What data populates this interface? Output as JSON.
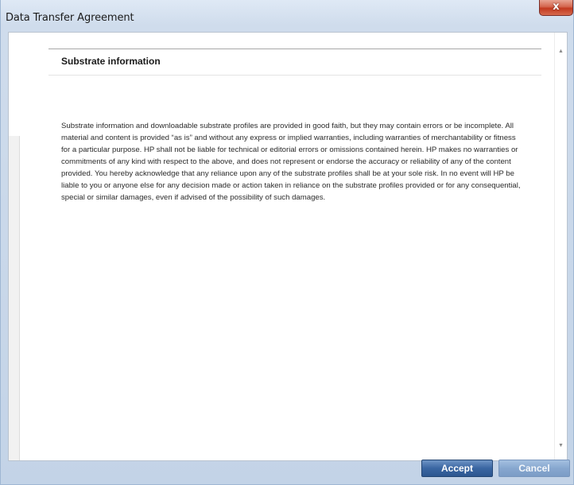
{
  "window": {
    "title": "Data Transfer Agreement",
    "close_glyph": "x",
    "close_icon": "close-icon"
  },
  "section": {
    "heading": "Substrate information",
    "body": "Substrate information and downloadable substrate profiles are provided in good faith, but they may contain errors or be incomplete. All material and content is provided “as is” and without any express or implied warranties, including warranties of merchantability or fitness for a particular purpose. HP shall not be liable for technical or editorial errors or omissions contained herein. HP makes no warranties or commitments of any kind with respect to the above, and does not represent or endorse the accuracy or reliability of any of the content provided. You hereby acknowledge that any reliance upon any of the substrate profiles shall be at your sole risk. In no event will HP be liable to you or anyone else for any decision made or action taken in reliance on the substrate profiles provided or for any consequential, special or similar damages, even if advised of the possibility of such damages."
  },
  "scrollbar": {
    "up_glyph": "▲",
    "down_glyph": "▼"
  },
  "footer": {
    "accept_label": "Accept",
    "cancel_label": "Cancel"
  },
  "colors": {
    "accept_button": "#3a66a2",
    "cancel_button": "#87a7cf",
    "close_button": "#c2391f",
    "titlebar": "#cfdcec"
  }
}
